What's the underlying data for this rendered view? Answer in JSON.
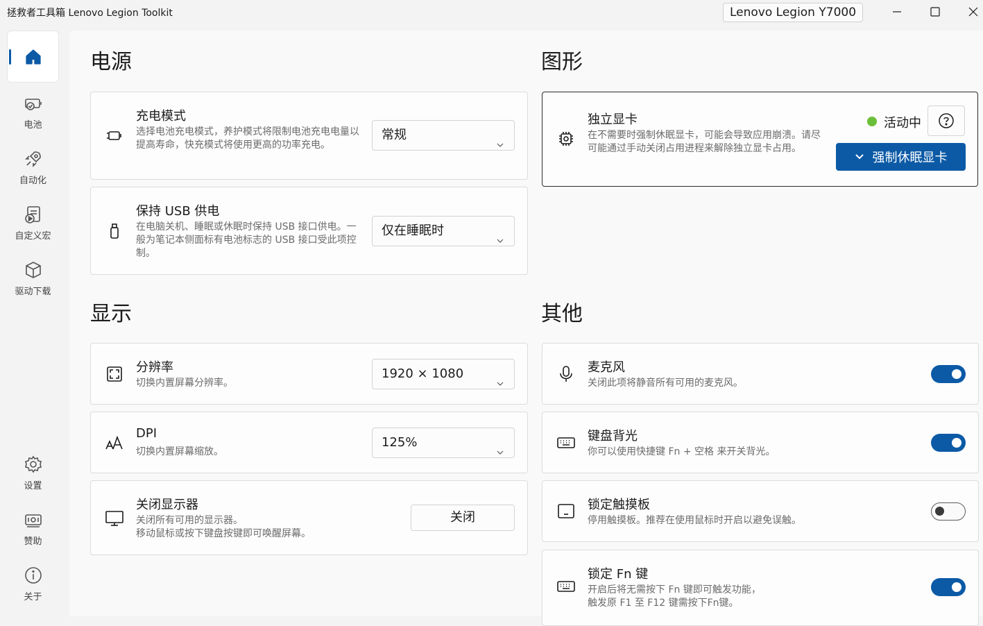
{
  "app": {
    "title": "拯救者工具箱 Lenovo Legion Toolkit",
    "device": "Lenovo Legion Y7000"
  },
  "sidebar": {
    "items": [
      {
        "label": "",
        "icon": "home-icon"
      },
      {
        "label": "电池",
        "icon": "battery-icon"
      },
      {
        "label": "自动化",
        "icon": "automation-icon"
      },
      {
        "label": "自定义宏",
        "icon": "macro-icon"
      },
      {
        "label": "驱动下载",
        "icon": "package-icon"
      },
      {
        "label": "设置",
        "icon": "gear-icon"
      },
      {
        "label": "赞助",
        "icon": "money-icon"
      },
      {
        "label": "关于",
        "icon": "info-icon"
      }
    ]
  },
  "sections": {
    "power": "电源",
    "graphics": "图形",
    "display": "显示",
    "other": "其他"
  },
  "power": {
    "charge_mode": {
      "title": "充电模式",
      "desc": "选择电池充电模式，养护模式将限制电池充电电量以提高寿命，快充模式将使用更高的功率充电。",
      "value": "常规"
    },
    "usb_power": {
      "title": "保持 USB 供电",
      "desc": "在电脑关机、睡眠或休眠时保持 USB 接口供电。一般为笔记本侧面标有电池标志的 USB 接口受此项控制。",
      "value": "仅在睡眠时"
    }
  },
  "graphics": {
    "dgpu": {
      "title": "独立显卡",
      "desc": "在不需要时强制休眠显卡，可能会导致应用崩溃。请尽可能通过手动关闭占用进程来解除独立显卡占用。",
      "status": "活动中",
      "status_color": "#6cbf3a",
      "action": "强制休眠显卡"
    }
  },
  "display": {
    "resolution": {
      "title": "分辨率",
      "desc": "切换内置屏幕分辨率。",
      "value": "1920 × 1080"
    },
    "dpi": {
      "title": "DPI",
      "desc": "切换内置屏幕缩放。",
      "value": "125%"
    },
    "turn_off": {
      "title": "关闭显示器",
      "desc": "关闭所有可用的显示器。\n移动鼠标或按下键盘按键即可唤醒屏幕。",
      "action": "关闭"
    }
  },
  "other": {
    "microphone": {
      "title": "麦克风",
      "desc": "关闭此项将静音所有可用的麦克风。",
      "on": true
    },
    "kb_backlight": {
      "title": "键盘背光",
      "desc": "你可以使用快捷键 Fn + 空格 来开关背光。",
      "on": true
    },
    "touchpad_lock": {
      "title": "锁定触摸板",
      "desc": "停用触摸板。推荐在使用鼠标时开启以避免误触。",
      "on": false
    },
    "fn_lock": {
      "title": "锁定 Fn 键",
      "desc": "开启后将无需按下 Fn 键即可触发功能，\n触发原 F1 至 F12 键需按下Fn键。",
      "on": true
    }
  },
  "colors": {
    "accent": "#0c5aa6",
    "background": "#f9f9f9",
    "sidebar": "#f3f3f3"
  }
}
